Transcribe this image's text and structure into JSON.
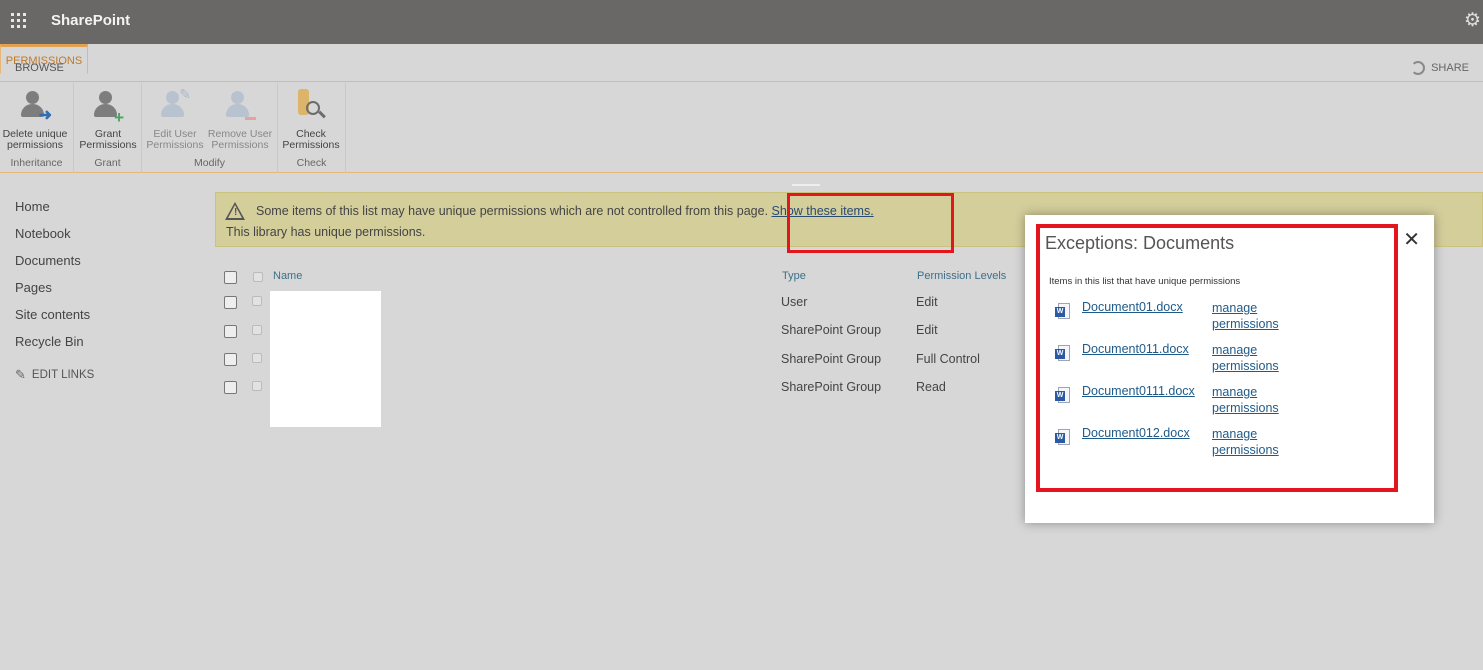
{
  "suitebar": {
    "app_title": "SharePoint"
  },
  "ribbon": {
    "tabs": [
      "BROWSE",
      "PERMISSIONS"
    ],
    "share_label": "SHARE",
    "groups": [
      {
        "label": "Inheritance",
        "buttons": [
          {
            "label1": "Delete unique",
            "label2": "permissions"
          }
        ]
      },
      {
        "label": "Grant",
        "buttons": [
          {
            "label1": "Grant",
            "label2": "Permissions"
          }
        ]
      },
      {
        "label": "Modify",
        "buttons": [
          {
            "label1": "Edit User",
            "label2": "Permissions"
          },
          {
            "label1": "Remove User",
            "label2": "Permissions"
          }
        ]
      },
      {
        "label": "Check",
        "buttons": [
          {
            "label1": "Check",
            "label2": "Permissions"
          }
        ]
      }
    ]
  },
  "leftnav": {
    "items": [
      "Home",
      "Notebook",
      "Documents",
      "Pages",
      "Site contents",
      "Recycle Bin"
    ],
    "edit_links": "EDIT LINKS"
  },
  "notice": {
    "line1_text": "Some items of this list may have unique permissions which are not controlled from this page.",
    "line1_link": "Show these items.",
    "line2_text": "This library has unique permissions."
  },
  "table": {
    "headers": {
      "name": "Name",
      "type": "Type",
      "permission_levels": "Permission Levels"
    },
    "rows": [
      {
        "type": "User",
        "level": "Edit"
      },
      {
        "type": "SharePoint Group",
        "level": "Edit"
      },
      {
        "type": "SharePoint Group",
        "level": "Full Control"
      },
      {
        "type": "SharePoint Group",
        "level": "Read"
      }
    ]
  },
  "callout": {
    "title": "Exceptions: Documents",
    "subtitle": "Items in this list that have unique permissions",
    "manage_label_1": "manage",
    "manage_label_2": "permissions",
    "documents": [
      "Document01.docx",
      "Document011.docx",
      "Document0111.docx",
      "Document012.docx"
    ]
  },
  "colors": {
    "suitebar": "#6a6867",
    "accent_orange": "#e0a152",
    "notice_bg": "#d4ce9b",
    "highlight_red": "#e3161d",
    "link_blue": "#1f5b8a"
  },
  "icons": [
    "waffle-icon",
    "gear-icon",
    "share-icon",
    "warning-icon",
    "word-doc-icon",
    "close-icon",
    "pencil-icon"
  ]
}
